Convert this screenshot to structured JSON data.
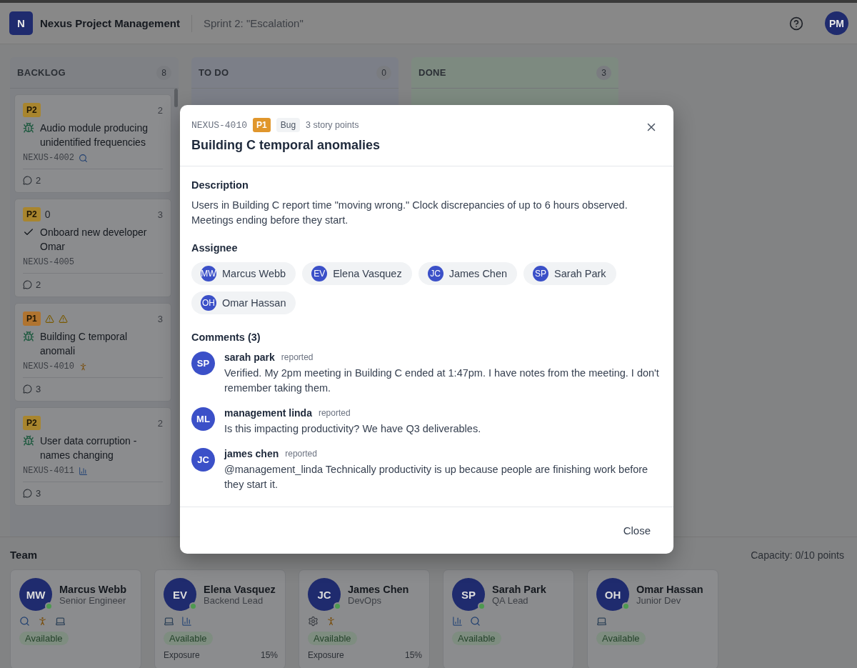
{
  "header": {
    "logo": "N",
    "title": "Nexus Project Management",
    "sprint": "Sprint 2: \"Escalation\"",
    "avatar": "PM"
  },
  "columns": [
    {
      "title": "BACKLOG",
      "count": "8",
      "kind": "backlog",
      "cards": [
        {
          "priority": "P2",
          "color": "#a8852e",
          "points": "2",
          "kind": "bug",
          "title": "Audio module producing unidentified frequencies",
          "id": "NEXUS-4002",
          "marker": {
            "kind": "search"
          },
          "comments": "2"
        },
        {
          "priority": "P2",
          "color": "#a8852e",
          "extra": "0",
          "points": "3",
          "kind": "task",
          "title": "Onboard new developer Omar",
          "id": "NEXUS-4005",
          "comments": "2"
        },
        {
          "priority": "P1",
          "color": "#b07430",
          "warnings": [
            {
              "kind": "warning"
            },
            {
              "kind": "warning"
            }
          ],
          "points": "3",
          "kind": "bug",
          "title": "Building C temporal anomali",
          "id": "NEXUS-4010",
          "marker": {
            "kind": "runner"
          },
          "comments": "3"
        },
        {
          "priority": "P2",
          "color": "#a8852e",
          "points": "2",
          "kind": "bug",
          "title": "User data corruption - names changing",
          "id": "NEXUS-4011",
          "marker": {
            "kind": "chart"
          },
          "comments": "3"
        }
      ]
    },
    {
      "title": "TO DO",
      "count": "0",
      "kind": "todo"
    },
    {
      "title": "DONE",
      "count": "3",
      "kind": "done"
    }
  ],
  "team": {
    "title": "Team",
    "capacity": "Capacity: 0/10 points",
    "members": [
      {
        "initials": "MW",
        "name": "Marcus Webb",
        "role": "Senior Engineer",
        "online": true,
        "skills": [
          {
            "kind": "search"
          },
          {
            "kind": "runner"
          },
          {
            "kind": "laptop"
          }
        ],
        "status": "Available"
      },
      {
        "initials": "EV",
        "name": "Elena Vasquez",
        "role": "Backend Lead",
        "online": true,
        "skills": [
          {
            "kind": "laptop"
          },
          {
            "kind": "chart"
          }
        ],
        "status": "Available",
        "exposure": "Exposure",
        "exposure_value": "15%"
      },
      {
        "initials": "JC",
        "name": "James Chen",
        "role": "DevOps",
        "online": true,
        "skills": [
          {
            "kind": "gear"
          },
          {
            "kind": "runner"
          }
        ],
        "status": "Available",
        "exposure": "Exposure",
        "exposure_value": "15%"
      },
      {
        "initials": "SP",
        "name": "Sarah Park",
        "role": "QA Lead",
        "online": true,
        "skills": [
          {
            "kind": "chart"
          },
          {
            "kind": "search"
          }
        ],
        "status": "Available"
      },
      {
        "initials": "OH",
        "name": "Omar Hassan",
        "role": "Junior Dev",
        "online": true,
        "skills": [
          {
            "kind": "laptop"
          }
        ],
        "status": "Available"
      }
    ]
  },
  "modal": {
    "id": "NEXUS-4010",
    "priority": "P1",
    "type": "Bug",
    "points": "3 story points",
    "title": "Building C temporal anomalies",
    "description_label": "Description",
    "description": "Users in Building C report time \"moving wrong.\" Clock discrepancies of up to 6 hours observed. Meetings ending before they start.",
    "assignee_label": "Assignee",
    "assignees": [
      {
        "initials": "MW",
        "name": "Marcus Webb"
      },
      {
        "initials": "EV",
        "name": "Elena Vasquez"
      },
      {
        "initials": "JC",
        "name": "James Chen"
      },
      {
        "initials": "SP",
        "name": "Sarah Park"
      },
      {
        "initials": "OH",
        "name": "Omar Hassan"
      }
    ],
    "comments_label": "Comments (3)",
    "comments": [
      {
        "initials": "SP",
        "author": "sarah park",
        "tag": "reported",
        "text": "Verified. My 2pm meeting in Building C ended at 1:47pm. I have notes from the meeting. I don't remember taking them."
      },
      {
        "initials": "ML",
        "author": "management linda",
        "tag": "reported",
        "text": "Is this impacting productivity? We have Q3 deliverables."
      },
      {
        "initials": "JC",
        "author": "james chen",
        "tag": "reported",
        "text": "@management_linda Technically productivity is up because people are finishing work before they start it."
      }
    ],
    "close": "Close"
  }
}
